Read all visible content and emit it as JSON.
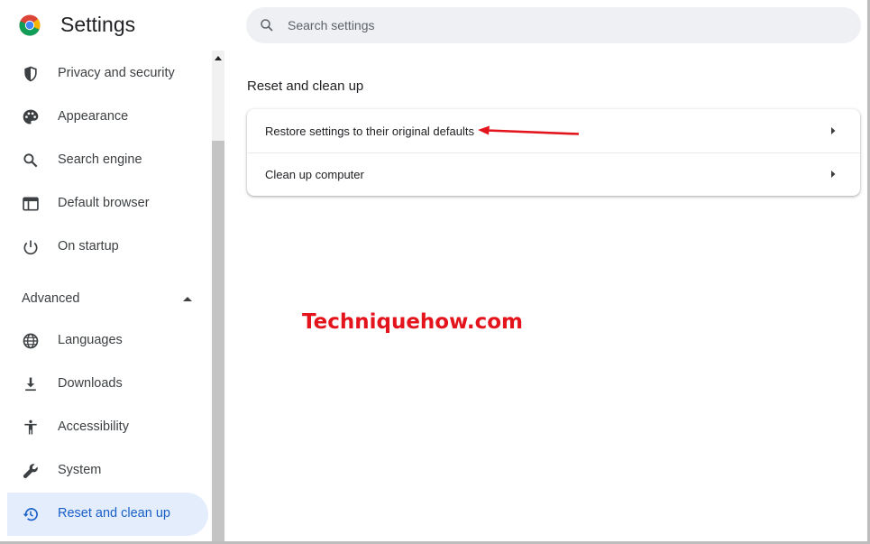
{
  "app": {
    "title": "Settings"
  },
  "search": {
    "placeholder": "Search settings",
    "value": ""
  },
  "sidebar": {
    "items": [
      {
        "label": "Privacy and security",
        "icon": "shield-icon"
      },
      {
        "label": "Appearance",
        "icon": "palette-icon"
      },
      {
        "label": "Search engine",
        "icon": "search-icon"
      },
      {
        "label": "Default browser",
        "icon": "browser-window-icon"
      },
      {
        "label": "On startup",
        "icon": "power-icon"
      }
    ],
    "advanced_label": "Advanced",
    "advanced_items": [
      {
        "label": "Languages",
        "icon": "globe-icon"
      },
      {
        "label": "Downloads",
        "icon": "download-icon"
      },
      {
        "label": "Accessibility",
        "icon": "accessibility-icon"
      },
      {
        "label": "System",
        "icon": "wrench-icon"
      },
      {
        "label": "Reset and clean up",
        "icon": "history-reset-icon",
        "active": true
      }
    ]
  },
  "main": {
    "section_title": "Reset and clean up",
    "rows": [
      {
        "label": "Restore settings to their original defaults"
      },
      {
        "label": "Clean up computer"
      }
    ]
  },
  "watermark": "Techniquehow.com",
  "colors": {
    "accent": "#1a73e8",
    "active_bg": "#e3edfc",
    "active_text": "#1a5fc7",
    "annotation": "#e3141b",
    "search_bg": "#eef0f3"
  }
}
